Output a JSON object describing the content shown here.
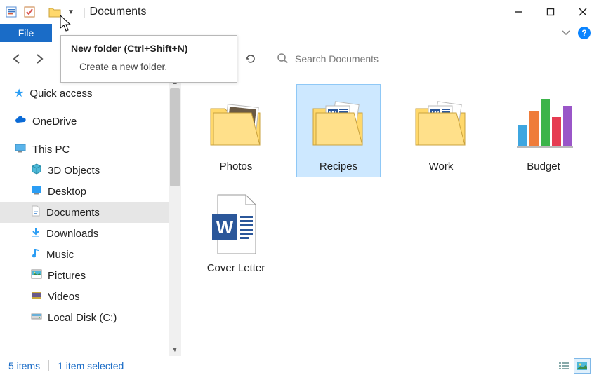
{
  "window": {
    "title": "Documents"
  },
  "ribbon": {
    "file_tab": "File"
  },
  "tooltip": {
    "title": "New folder (Ctrl+Shift+N)",
    "body": "Create a new folder."
  },
  "search": {
    "placeholder": "Search Documents"
  },
  "nav": {
    "quick_access": "Quick access",
    "onedrive": "OneDrive",
    "this_pc": "This PC",
    "children": {
      "objects3d": "3D Objects",
      "desktop": "Desktop",
      "documents": "Documents",
      "downloads": "Downloads",
      "music": "Music",
      "pictures": "Pictures",
      "videos": "Videos",
      "localdisk": "Local Disk (C:)"
    }
  },
  "items": {
    "photos": "Photos",
    "recipes": "Recipes",
    "work": "Work",
    "budget": "Budget",
    "cover_letter": "Cover Letter"
  },
  "status": {
    "count": "5 items",
    "selected": "1 item selected"
  }
}
